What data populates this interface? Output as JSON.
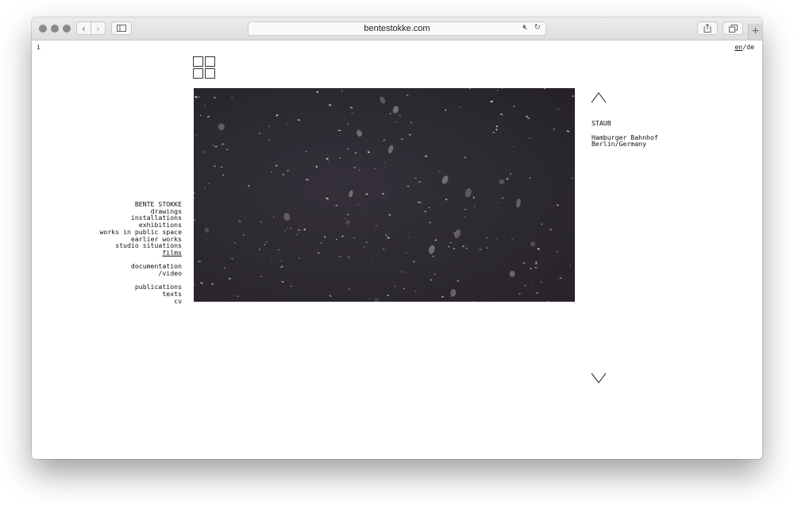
{
  "browser": {
    "url": "bentestokke.com"
  },
  "page": {
    "info_link": "i",
    "lang": {
      "en": "en",
      "separator": "/",
      "de": "de"
    },
    "nav": {
      "site_name": "BENTE STOKKE",
      "group1": [
        "drawings",
        "installations",
        "exhibitions",
        "works in public space",
        "earlier works",
        "studio situations"
      ],
      "current": "films",
      "group2": [
        "documentation",
        "/video"
      ],
      "group3": [
        "publications",
        "texts",
        "cv"
      ]
    },
    "work": {
      "title": "STAUB",
      "location_line1": "Hamburger Bahnhof",
      "location_line2": "Berlin/Germany"
    },
    "icons": {
      "grid": "grid-view-icon",
      "prev": "chevron-up-icon",
      "next": "chevron-down-icon"
    }
  }
}
